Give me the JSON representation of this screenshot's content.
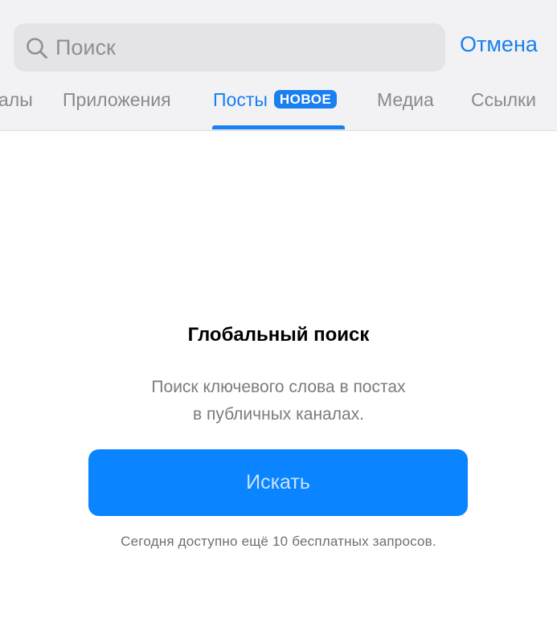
{
  "search": {
    "placeholder": "Поиск",
    "value": "",
    "icon": "search-icon",
    "cancel_label": "Отмена"
  },
  "tabs": [
    {
      "label": "алы",
      "active": false
    },
    {
      "label": "Приложения",
      "active": false
    },
    {
      "label": "Посты",
      "badge": "НОВОЕ",
      "active": true
    },
    {
      "label": "Медиа",
      "active": false
    },
    {
      "label": "Ссылки",
      "active": false
    }
  ],
  "empty_state": {
    "title": "Глобальный поиск",
    "description_line1": "Поиск ключевого слова в постах",
    "description_line2": "в публичных каналах.",
    "button_label": "Искать",
    "quota_text": "Сегодня доступно ещё 10 бесплатных запросов."
  },
  "colors": {
    "accent": "#1a7ff0",
    "button": "#0a84ff",
    "header_bg": "#f2f2f4"
  }
}
